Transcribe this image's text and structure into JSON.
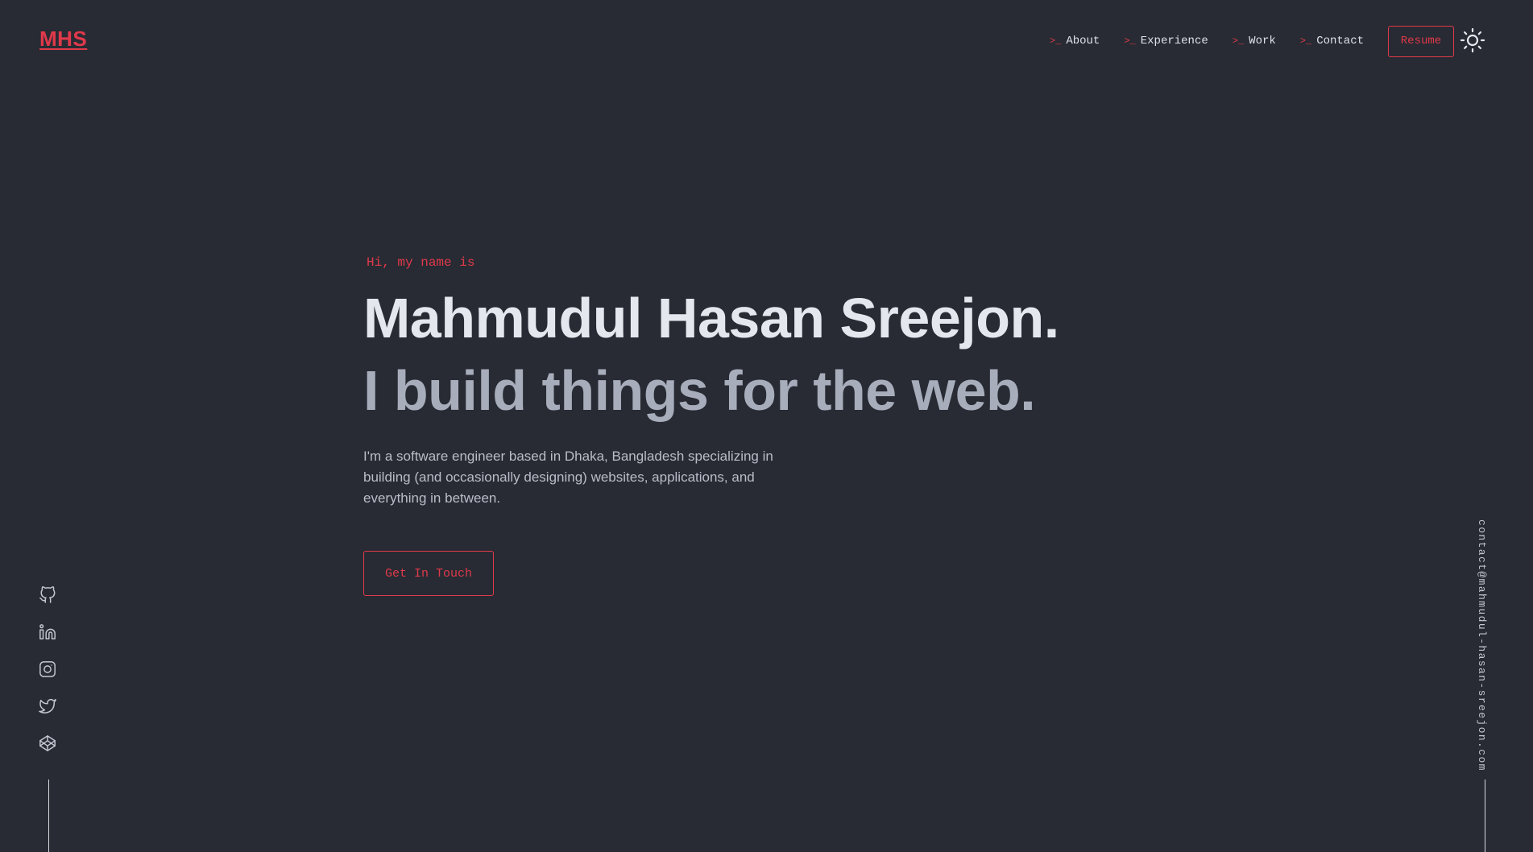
{
  "header": {
    "logo": "MHS",
    "nav": [
      {
        "prompt": ">_",
        "label": "About"
      },
      {
        "prompt": ">_",
        "label": "Experience"
      },
      {
        "prompt": ">_",
        "label": "Work"
      },
      {
        "prompt": ">_",
        "label": "Contact"
      }
    ],
    "resume_label": "Resume",
    "theme_toggle_icon": "sun-icon"
  },
  "hero": {
    "greeting": "Hi, my name is",
    "name": "Mahmudul Hasan Sreejon.",
    "tagline": "I build things for the web.",
    "bio": "I'm a software engineer based in Dhaka, Bangladesh specializing in building (and occasionally designing) websites, applications, and everything in between.",
    "cta_label": "Get In Touch"
  },
  "social": [
    "github-icon",
    "linkedin-icon",
    "instagram-icon",
    "twitter-icon",
    "codepen-icon"
  ],
  "email": "contact@mahmudul-hasan-sreejon.com",
  "colors": {
    "background": "#282b33",
    "accent": "#e0394b",
    "heading": "#e4e7ee",
    "subheading": "#a7adbb",
    "body": "#b9bdc8"
  }
}
